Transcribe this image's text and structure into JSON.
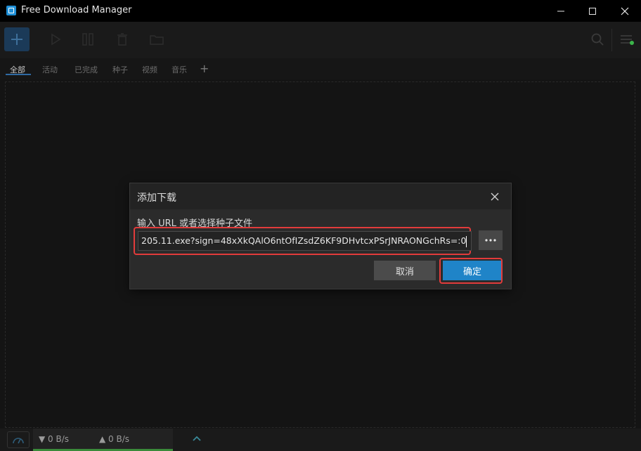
{
  "window": {
    "title": "Free Download Manager"
  },
  "tabs": [
    {
      "label": "全部",
      "active": true
    },
    {
      "label": "活动"
    },
    {
      "label": "已完成"
    },
    {
      "label": "种子"
    },
    {
      "label": "视频"
    },
    {
      "label": "音乐"
    }
  ],
  "dialog": {
    "title": "添加下载",
    "prompt": "输入 URL 或者选择种子文件",
    "url_value": "205.11.exe?sign=48xXkQAlO6ntOfIZsdZ6KF9DHvtcxPSrJNRAONGchRs=:0",
    "cancel_label": "取消",
    "ok_label": "确定"
  },
  "status": {
    "download_speed": "0 B/s",
    "upload_speed": "0 B/s"
  },
  "colors": {
    "accent": "#1f84c8",
    "highlight": "#e23b3b",
    "active_dot": "#3bb54a"
  }
}
